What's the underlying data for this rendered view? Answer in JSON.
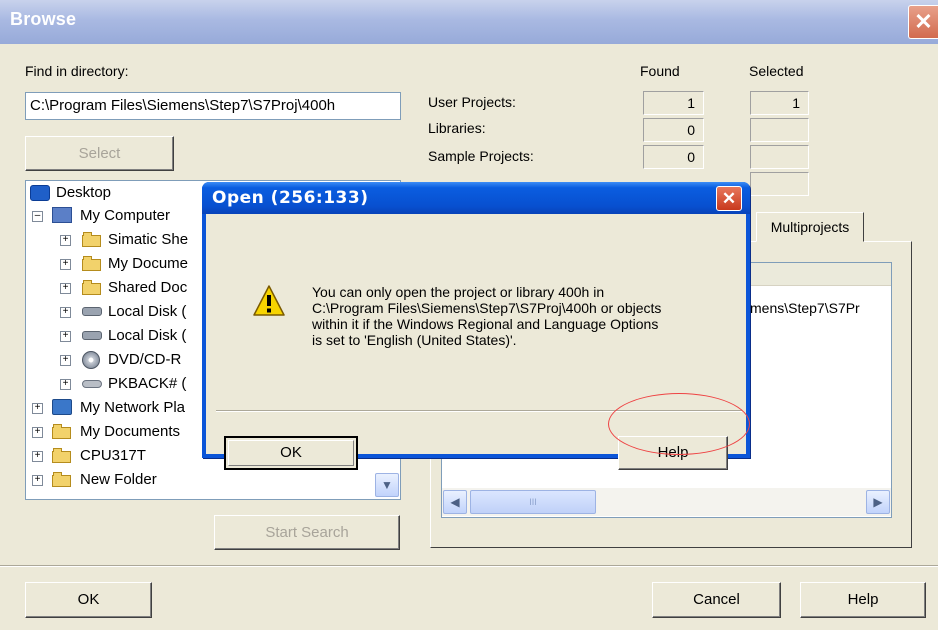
{
  "browse": {
    "title": "Browse",
    "close_glyph": "✕",
    "find_label": "Find in directory:",
    "directory_value": "C:\\Program Files\\Siemens\\Step7\\S7Proj\\400h",
    "select_button": "Select",
    "found_header": "Found",
    "selected_header": "Selected",
    "rows": [
      {
        "label": "User Projects:",
        "found": "1",
        "selected": "1"
      },
      {
        "label": "Libraries:",
        "found": "0",
        "selected": ""
      },
      {
        "label": "Sample Projects:",
        "found": "0",
        "selected": ""
      }
    ],
    "tree": [
      {
        "label": "Desktop",
        "icon": "desktop-icon"
      },
      {
        "label": "My Computer",
        "icon": "computer-icon"
      },
      {
        "label": "Simatic She",
        "icon": "folder-icon"
      },
      {
        "label": "My Docume",
        "icon": "folder-icon"
      },
      {
        "label": "Shared Doc",
        "icon": "folder-icon"
      },
      {
        "label": "Local Disk (",
        "icon": "drive-icon"
      },
      {
        "label": "Local Disk (",
        "icon": "drive-icon"
      },
      {
        "label": "DVD/CD-R",
        "icon": "cd-drive-icon"
      },
      {
        "label": "PKBACK# (",
        "icon": "drive-icon"
      },
      {
        "label": "My Network Pla",
        "icon": "network-icon"
      },
      {
        "label": "My Documents",
        "icon": "documents-icon"
      },
      {
        "label": "CPU317T",
        "icon": "folder-icon"
      },
      {
        "label": "New Folder",
        "icon": "folder-icon"
      }
    ],
    "start_search_button": "Start Search",
    "multiprojects_tab": "Multiprojects",
    "list_path_fragment": "mens\\Step7\\S7Pr",
    "scroll_thumb_grip": "III",
    "ok_button": "OK",
    "cancel_button": "Cancel",
    "help_button": "Help"
  },
  "dialog": {
    "title": "Open  (256:133)",
    "close_glyph": "✕",
    "icon": "warning-icon",
    "message_lines": [
      "You can only open the project or library 400h in",
      "C:\\Program Files\\Siemens\\Step7\\S7Proj\\400h or objects",
      "within it if the Windows Regional and Language Options",
      "is set to 'English (United States)'."
    ],
    "ok_button": "OK",
    "help_button": "Help"
  },
  "colors": {
    "dialog_title_blue": "#0a5de0",
    "annotation_circle": "#e44444"
  }
}
